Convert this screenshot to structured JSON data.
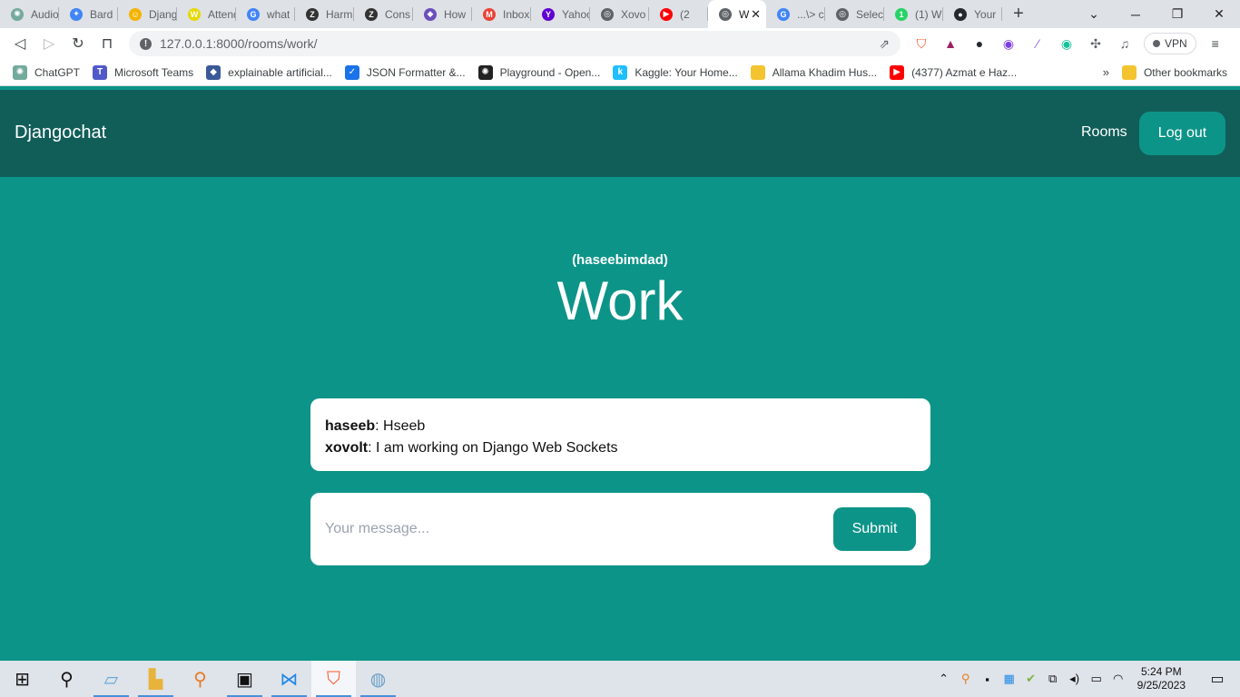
{
  "browser": {
    "tabs": [
      {
        "label": "Audio",
        "icon": "chatgpt-icon",
        "color": "#74aa9c",
        "glyph": "✺"
      },
      {
        "label": "Bard",
        "icon": "bard-icon",
        "color": "#4285f4",
        "glyph": "✦"
      },
      {
        "label": "Django",
        "icon": "django-icon",
        "color": "#f4b400",
        "glyph": "☺"
      },
      {
        "label": "Attend",
        "icon": "attend-icon",
        "color": "#e6d800",
        "glyph": "W"
      },
      {
        "label": "what",
        "icon": "google-icon",
        "color": "#4285f4",
        "glyph": "G"
      },
      {
        "label": "Harm",
        "icon": "zed-icon",
        "color": "#333333",
        "glyph": "Z"
      },
      {
        "label": "Cons",
        "icon": "zed-icon",
        "color": "#333333",
        "glyph": "Z"
      },
      {
        "label": "How",
        "icon": "phind-icon",
        "color": "#6b4fbb",
        "glyph": "◆"
      },
      {
        "label": "Inbox",
        "icon": "gmail-icon",
        "color": "#ea4335",
        "glyph": "M"
      },
      {
        "label": "Yahoo",
        "icon": "yahoo-icon",
        "color": "#6001d2",
        "glyph": "Y"
      },
      {
        "label": "Xovo",
        "icon": "globe-icon",
        "color": "#5f6368",
        "glyph": "◎"
      },
      {
        "label": "(2",
        "icon": "youtube-icon",
        "color": "#ff0000",
        "glyph": "▶"
      },
      {
        "label": "W",
        "icon": "globe-icon",
        "color": "#5f6368",
        "glyph": "◎"
      },
      {
        "label": "...\\> c",
        "icon": "google-icon",
        "color": "#4285f4",
        "glyph": "G"
      },
      {
        "label": "Selec",
        "icon": "globe-icon",
        "color": "#5f6368",
        "glyph": "◎"
      },
      {
        "label": "(1) W",
        "icon": "whatsapp-icon",
        "color": "#25d366",
        "glyph": "1"
      },
      {
        "label": "Your",
        "icon": "github-icon",
        "color": "#24292f",
        "glyph": "●"
      }
    ],
    "url": "127.0.0.1:8000/rooms/work/",
    "vpn_label": "VPN",
    "bookmarks": [
      {
        "label": "ChatGPT",
        "color": "#74aa9c",
        "glyph": "✺"
      },
      {
        "label": "Microsoft Teams",
        "color": "#5059c9",
        "glyph": "T"
      },
      {
        "label": "explainable artificial...",
        "color": "#3b5998",
        "glyph": "◆"
      },
      {
        "label": "JSON Formatter &...",
        "color": "#1a73e8",
        "glyph": "✓"
      },
      {
        "label": "Playground - Open...",
        "color": "#222222",
        "glyph": "✺"
      },
      {
        "label": "Kaggle: Your Home...",
        "color": "#20beff",
        "glyph": "k"
      },
      {
        "label": "Allama Khadim Hus...",
        "color": "#f4c430",
        "glyph": ""
      },
      {
        "label": "(4377) Azmat e Haz...",
        "color": "#ff0000",
        "glyph": "▶"
      }
    ],
    "other_bookmarks": "Other bookmarks"
  },
  "site": {
    "brand": "Djangochat",
    "nav_rooms": "Rooms",
    "logout": "Log out"
  },
  "room": {
    "username": "(haseebimdad)",
    "title": "Work",
    "messages": [
      {
        "user": "haseeb",
        "text": "Hseeb"
      },
      {
        "user": "xovolt",
        "text": "I am working on Django Web Sockets"
      }
    ],
    "input_placeholder": "Your message...",
    "input_value": "",
    "submit_label": "Submit"
  },
  "taskbar": {
    "time": "5:24 PM",
    "date": "9/25/2023"
  },
  "colors": {
    "page_bg": "#0d9488",
    "navbar_bg": "#115e59",
    "accent": "#0d9488"
  }
}
